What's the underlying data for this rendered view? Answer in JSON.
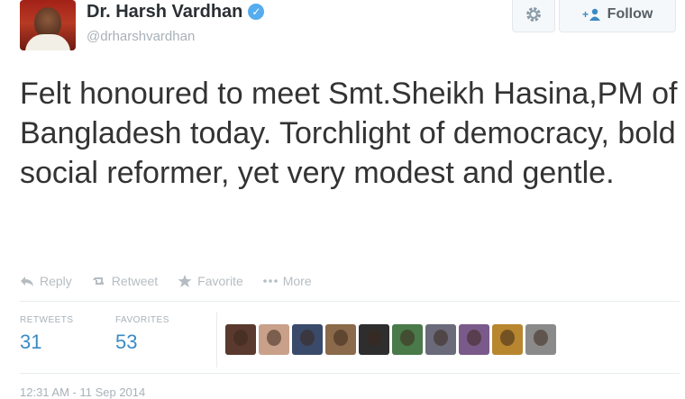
{
  "author": {
    "name": "Dr. Harsh Vardhan",
    "handle": "@drharshvardhan",
    "verified": true
  },
  "header": {
    "follow_label": "Follow",
    "gear_icon": "gear-icon",
    "follow_icon": "add-user-icon"
  },
  "tweet": {
    "text": "Felt honoured to meet Smt.Sheikh Hasina,PM of Bangladesh today. Torchlight of democracy, bold social reformer, yet very modest and gentle."
  },
  "actions": [
    {
      "label": "Reply",
      "icon": "reply-icon"
    },
    {
      "label": "Retweet",
      "icon": "retweet-icon"
    },
    {
      "label": "Favorite",
      "icon": "star-icon"
    },
    {
      "label": "More",
      "icon": "more-icon"
    }
  ],
  "stats": {
    "retweets_label": "RETWEETS",
    "retweets_value": "31",
    "favorites_label": "FAVORITES",
    "favorites_value": "53"
  },
  "favoriters": [
    {
      "color": "#5a3a2e"
    },
    {
      "color": "#c9a08a"
    },
    {
      "color": "#3a4a6a"
    },
    {
      "color": "#8a6a4a"
    },
    {
      "color": "#2e2e2e"
    },
    {
      "color": "#4a7a4a"
    },
    {
      "color": "#6a6a7a"
    },
    {
      "color": "#7a5a8a"
    },
    {
      "color": "#b8862e"
    },
    {
      "color": "#8a8a8a"
    }
  ],
  "timestamp": "12:31 AM - 11 Sep 2014",
  "colors": {
    "link": "#3b8bc4",
    "verified": "#55acee",
    "muted": "#a8b1b8"
  }
}
